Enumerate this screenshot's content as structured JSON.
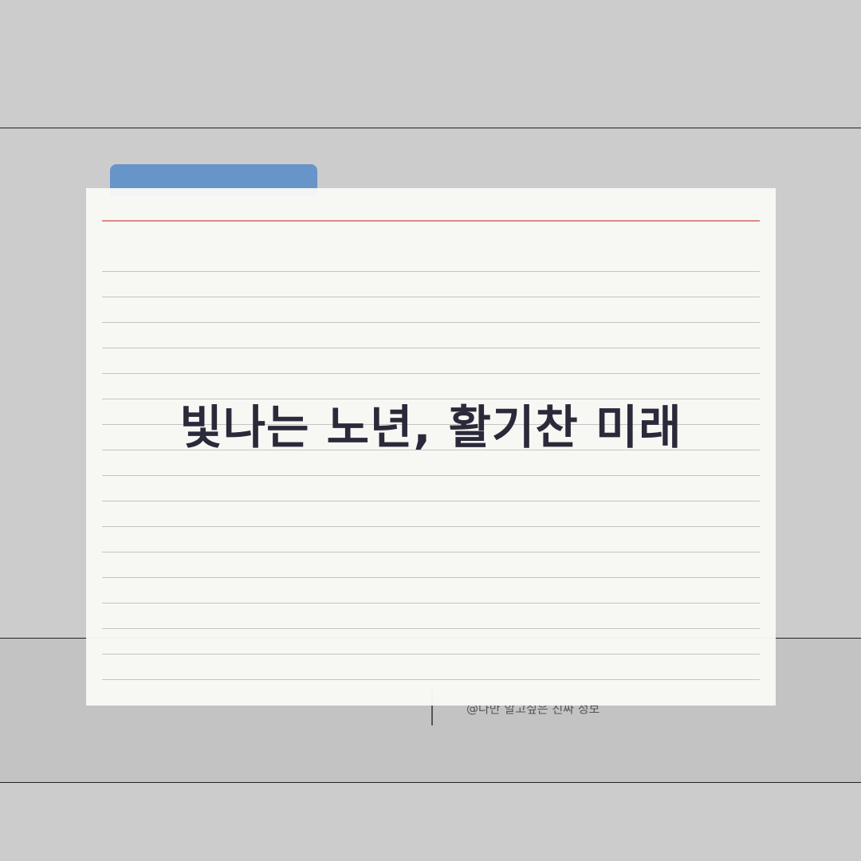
{
  "card": {
    "title": "빛나는 노년, 활기찬 미래"
  },
  "footer": {
    "credit": "@나만 알고싶은 진짜 정보"
  },
  "colors": {
    "background": "#cccccc",
    "tab": "#6794c9",
    "paper": "#f9f9f6",
    "red_rule": "#d88a86",
    "title_text": "#2a2a3a"
  }
}
